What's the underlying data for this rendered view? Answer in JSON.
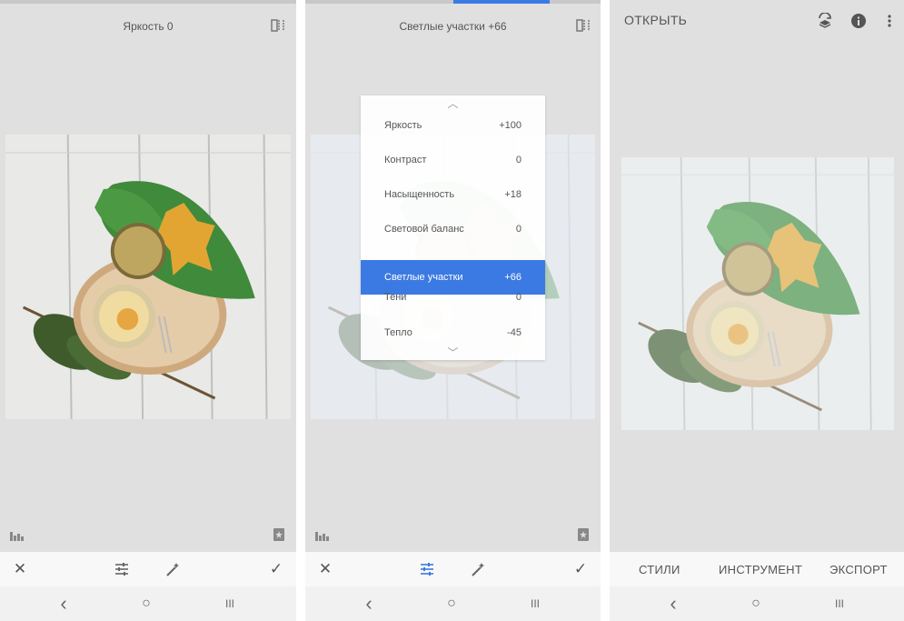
{
  "panel1": {
    "title": "Яркость 0",
    "icons": {
      "compare": "compare-icon",
      "histogram": "histogram-icon",
      "save": "bookmark-icon",
      "close": "close-icon",
      "tune": "tune-icon",
      "auto": "magic-wand-icon",
      "apply": "check-icon"
    }
  },
  "panel2": {
    "title": "Светлые участки +66",
    "menu": [
      {
        "label": "Яркость",
        "value": "+100"
      },
      {
        "label": "Контраст",
        "value": "0"
      },
      {
        "label": "Насыщенность",
        "value": "+18"
      },
      {
        "label": "Световой баланс",
        "value": "0"
      },
      {
        "label": "Светлые участки",
        "value": "+66",
        "selected": true
      },
      {
        "label": "Тени",
        "value": "0"
      },
      {
        "label": "Тепло",
        "value": "-45"
      }
    ],
    "accent": "#3b7ae2"
  },
  "panel3": {
    "open_label": "ОТКРЫТЬ",
    "tabs": [
      "СТИЛИ",
      "ИНСТРУМЕНТ",
      "ЭКСПОРТ"
    ],
    "icons": {
      "layers": "layers-undo-icon",
      "info": "info-icon",
      "more": "more-vert-icon"
    }
  },
  "nav": {
    "back": "‹",
    "home": "○",
    "recent": "III"
  }
}
